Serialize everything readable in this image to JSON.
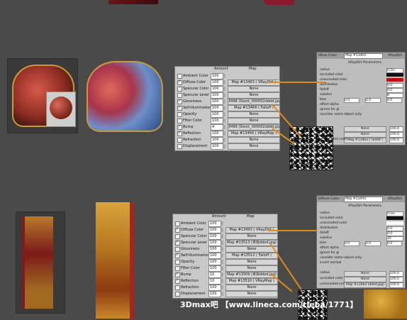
{
  "table_headers": {
    "amount": "Amount",
    "map": "Map"
  },
  "top_table": [
    {
      "label": "Ambient Color",
      "amount": "100",
      "map": "",
      "checked": false
    },
    {
      "label": "Diffuse Color",
      "amount": "100",
      "map": "Map #13463  ( VRayDirt )",
      "checked": true
    },
    {
      "label": "Specular Color",
      "amount": "100",
      "map": "None",
      "checked": false
    },
    {
      "label": "Specular Level",
      "amount": "100",
      "map": "None",
      "checked": false
    },
    {
      "label": "Glossiness",
      "amount": "100",
      "map": "3498 (Stock_000002dddd.jpg)",
      "checked": true
    },
    {
      "label": "Self-Illumination",
      "amount": "100",
      "map": "Map #13466  ( Falloff )",
      "checked": true
    },
    {
      "label": "Opacity",
      "amount": "100",
      "map": "None",
      "checked": false
    },
    {
      "label": "Filter Color",
      "amount": "100",
      "map": "None",
      "checked": false
    },
    {
      "label": "Bump",
      "amount": "4",
      "map": "3499 (Stock_000002dddd.jpg)",
      "checked": true
    },
    {
      "label": "Reflection",
      "amount": "100",
      "map": "Map #13464  ( VRayMap )",
      "checked": true
    },
    {
      "label": "Refraction",
      "amount": "100",
      "map": "None",
      "checked": false
    },
    {
      "label": "Displacement",
      "amount": "100",
      "map": "None",
      "checked": false
    }
  ],
  "bottom_table": [
    {
      "label": "Ambient Color",
      "amount": "100",
      "map": "",
      "checked": false
    },
    {
      "label": "Diffuse Color",
      "amount": "100",
      "map": "Map #13493  ( VRayDirt )",
      "checked": true
    },
    {
      "label": "Specular Color",
      "amount": "100",
      "map": "None",
      "checked": false
    },
    {
      "label": "Specular Level",
      "amount": "100",
      "map": "Map #13513 (未标dded.jpg)",
      "checked": true
    },
    {
      "label": "Glossiness",
      "amount": "100",
      "map": "None",
      "checked": false
    },
    {
      "label": "Self-Illumination",
      "amount": "100",
      "map": "Map #13512  ( Falloff )",
      "checked": true
    },
    {
      "label": "Opacity",
      "amount": "100",
      "map": "None",
      "checked": false
    },
    {
      "label": "Filter Color",
      "amount": "100",
      "map": "None",
      "checked": false
    },
    {
      "label": "Bump",
      "amount": "10",
      "map": "Map #13509 (未标dded.jpg)",
      "checked": true
    },
    {
      "label": "Reflection",
      "amount": "10",
      "map": "Map #13510  ( VRayMap )",
      "checked": true
    },
    {
      "label": "Refraction",
      "amount": "100",
      "map": "None",
      "checked": false
    },
    {
      "label": "Displacement",
      "amount": "100",
      "map": "None",
      "checked": false
    }
  ],
  "top_panel": {
    "slot_label": "iffuse Color:",
    "map_name": "Map #13463",
    "map_type": "VRayDirt",
    "rollout_title": "VRayDirt Parameters",
    "rows": [
      "radius",
      "occluded color",
      "unoccluded color",
      "distribution",
      "falloff",
      "subdivs",
      "bias",
      "affect alpha",
      "ignore for gi",
      "consider same object only"
    ],
    "values": {
      "radius": "0.5in",
      "distribution": "0.0",
      "falloff": "0.0",
      "subdivs": "8",
      "bias_x": "0.0",
      "bias_y": "0.0",
      "bias_z": "0.0"
    },
    "map_rows": [
      {
        "label": "None",
        "amount": "100.0"
      },
      {
        "label": "None",
        "amount": "100.0"
      },
      {
        "label": "Map #13463 ( Falloff )",
        "amount": "100.0"
      }
    ],
    "map_row_labels": [
      "",
      "",
      "unoccluded color"
    ]
  },
  "bottom_panel": {
    "slot_label": "Diffuse Color:",
    "map_name": "Map #13493",
    "map_type": "VRayDirt",
    "rollout_title": "VRayDirt Parameters",
    "rows": [
      "radius",
      "occluded color",
      "unoccluded color",
      "distribution",
      "falloff",
      "subdivs",
      "bias",
      "affect alpha",
      "ignore for gi",
      "consider same object only",
      "invert normal"
    ],
    "values": {
      "radius": "0.5in",
      "distribution": "0.0",
      "falloff": "0.0",
      "subdivs": "10",
      "bias_x": "0.0",
      "bias_y": "0.0",
      "bias_z": "0.0"
    },
    "map_rows": [
      {
        "label": "radius",
        "value": "None",
        "amount": "100.0"
      },
      {
        "label": "occluded color",
        "value": "None",
        "amount": "100.0"
      },
      {
        "label": "unoccluded color",
        "value": "Map #13493 (dded.jpg)",
        "amount": "100.0"
      }
    ]
  },
  "watermark": "3Dmax吧 【www.lineca.com/tieba/1771】",
  "colors": {
    "background": "#4a4a4a",
    "wire": "#e08a1c",
    "panel": "#c8c8c8",
    "red_swatch": "#c01010"
  }
}
